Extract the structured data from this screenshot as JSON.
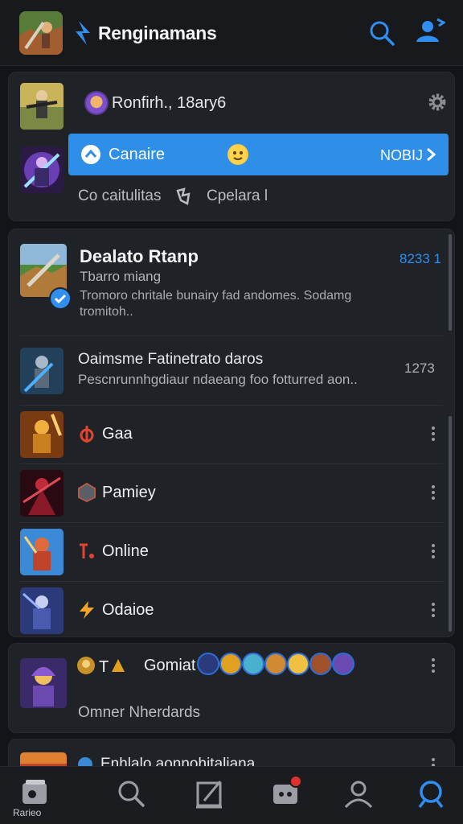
{
  "header": {
    "title": "Renginamans",
    "icons": [
      "game-thumbnail",
      "bolt-icon",
      "search-icon",
      "add-user-icon"
    ]
  },
  "account_card": {
    "name": "Ronfirh., 18ary6",
    "status_label": "Canaire",
    "action_label": "NOBIJ",
    "footer_left": "Co caitulitas",
    "footer_right": "Cpelara l"
  },
  "featured": {
    "title": "Dealato Rtanp",
    "subtitle": "Tbarro miang",
    "description": "Tromoro chritale bunairy fad andomes. Sodamg tromitoh..",
    "time": "8233 1"
  },
  "list_rows": [
    {
      "title": "Oaimsme Fatinetrato daros",
      "subtitle": "Pescnrunnhgdiaur ndaeang foo fotturred aon..",
      "count": "1273"
    }
  ],
  "menu_items": [
    {
      "label": "Gaa",
      "icon": "phi-icon",
      "color": "#e2452f"
    },
    {
      "label": "Pamiey",
      "icon": "hex-icon",
      "color": "#b05a48"
    },
    {
      "label": "Online",
      "icon": "letter-icon",
      "color": "#e2452f"
    },
    {
      "label": "Odaioe",
      "icon": "bolt-icon",
      "color": "#f5a623"
    }
  ],
  "group_card": {
    "name": "Gomiat",
    "prefix": "T",
    "subtitle": "Omner Nherdards"
  },
  "partial_card": {
    "text": "Enhlalo aonnohitaliana"
  },
  "bottom_nav": {
    "first_label": "Rarieo",
    "items": [
      "chat-icon",
      "search-icon",
      "edit-icon",
      "inbox-icon",
      "profile-icon",
      "explore-search-icon"
    ]
  },
  "colors": {
    "accent": "#2f8ef0",
    "background": "#121417",
    "card": "#1f2226"
  }
}
